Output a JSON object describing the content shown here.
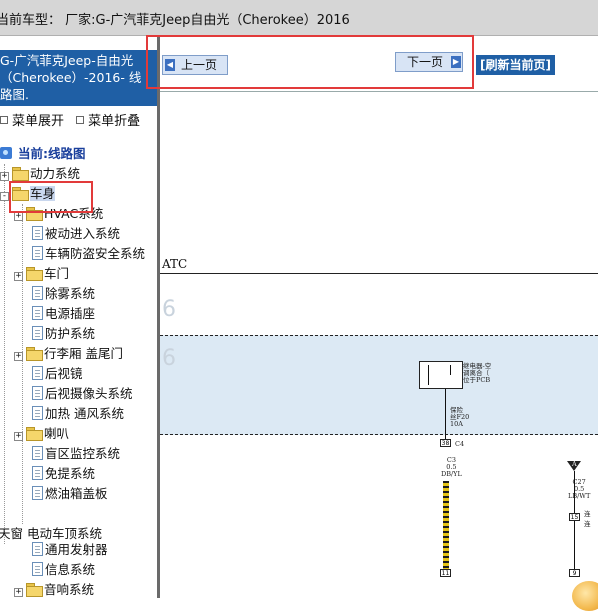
{
  "topbar": {
    "current_vehicle": "当前车型： 厂家:G-广汽菲克Jeep自由光（Cherokee）2016"
  },
  "sidebar": {
    "header_lines": [
      "G-广汽菲克Jeep-自由光",
      "（Cherokee）-2016- 线",
      "路图."
    ],
    "expand_all": "菜单展开",
    "collapse_all": "菜单折叠",
    "current": "当前:线路图",
    "tree": [
      {
        "label": "动力系统",
        "type": "folder"
      },
      {
        "label": "车身",
        "type": "folder",
        "selected": true
      },
      {
        "label": "HVAC系统",
        "type": "folder"
      },
      {
        "label": "被动进入系统",
        "type": "doc"
      },
      {
        "label": "车辆防盗安全系统",
        "type": "doc"
      },
      {
        "label": "车门",
        "type": "folder"
      },
      {
        "label": "除雾系统",
        "type": "doc"
      },
      {
        "label": "电源插座",
        "type": "doc"
      },
      {
        "label": "防护系统",
        "type": "doc"
      },
      {
        "label": "行李厢 盖尾门",
        "type": "folder"
      },
      {
        "label": "后视镜",
        "type": "doc"
      },
      {
        "label": "后视摄像头系统",
        "type": "doc"
      },
      {
        "label": "加热 通风系统",
        "type": "doc"
      },
      {
        "label": "喇叭",
        "type": "folder"
      },
      {
        "label": "盲区监控系统",
        "type": "doc"
      },
      {
        "label": "免提系统",
        "type": "doc"
      },
      {
        "label": "燃油箱盖板",
        "type": "doc"
      },
      {
        "label": "天窗 电动车顶系统",
        "type": "text"
      },
      {
        "label": "通用发射器",
        "type": "doc"
      },
      {
        "label": "信息系统",
        "type": "doc"
      },
      {
        "label": "音响系统",
        "type": "folder"
      }
    ]
  },
  "nav": {
    "prev": "上一页",
    "next": "下一页",
    "refresh": "[刷新当前页]"
  },
  "diagram": {
    "module": "ATC",
    "relay_text": [
      "继电器-空",
      "调离合（",
      "位于PCB"
    ],
    "fuse_text": [
      "保险",
      "丝F20",
      "10A"
    ],
    "pin_38": "38",
    "conn_c4": "C4",
    "wire_left": [
      "C3",
      "0.5",
      "DB/YL"
    ],
    "wire_right": [
      "C27",
      "0.5",
      "LB/WT"
    ],
    "pin_15": "15",
    "pin_11": "11",
    "pin_9": "9",
    "ground_a": "A",
    "side_text": [
      "连",
      "连"
    ]
  },
  "colors": {
    "header_blue": "#1f5fa5",
    "highlight_red": "#e23a3a",
    "diagram_band": "#dce9f4",
    "wire_yellow": "#e3c317"
  }
}
